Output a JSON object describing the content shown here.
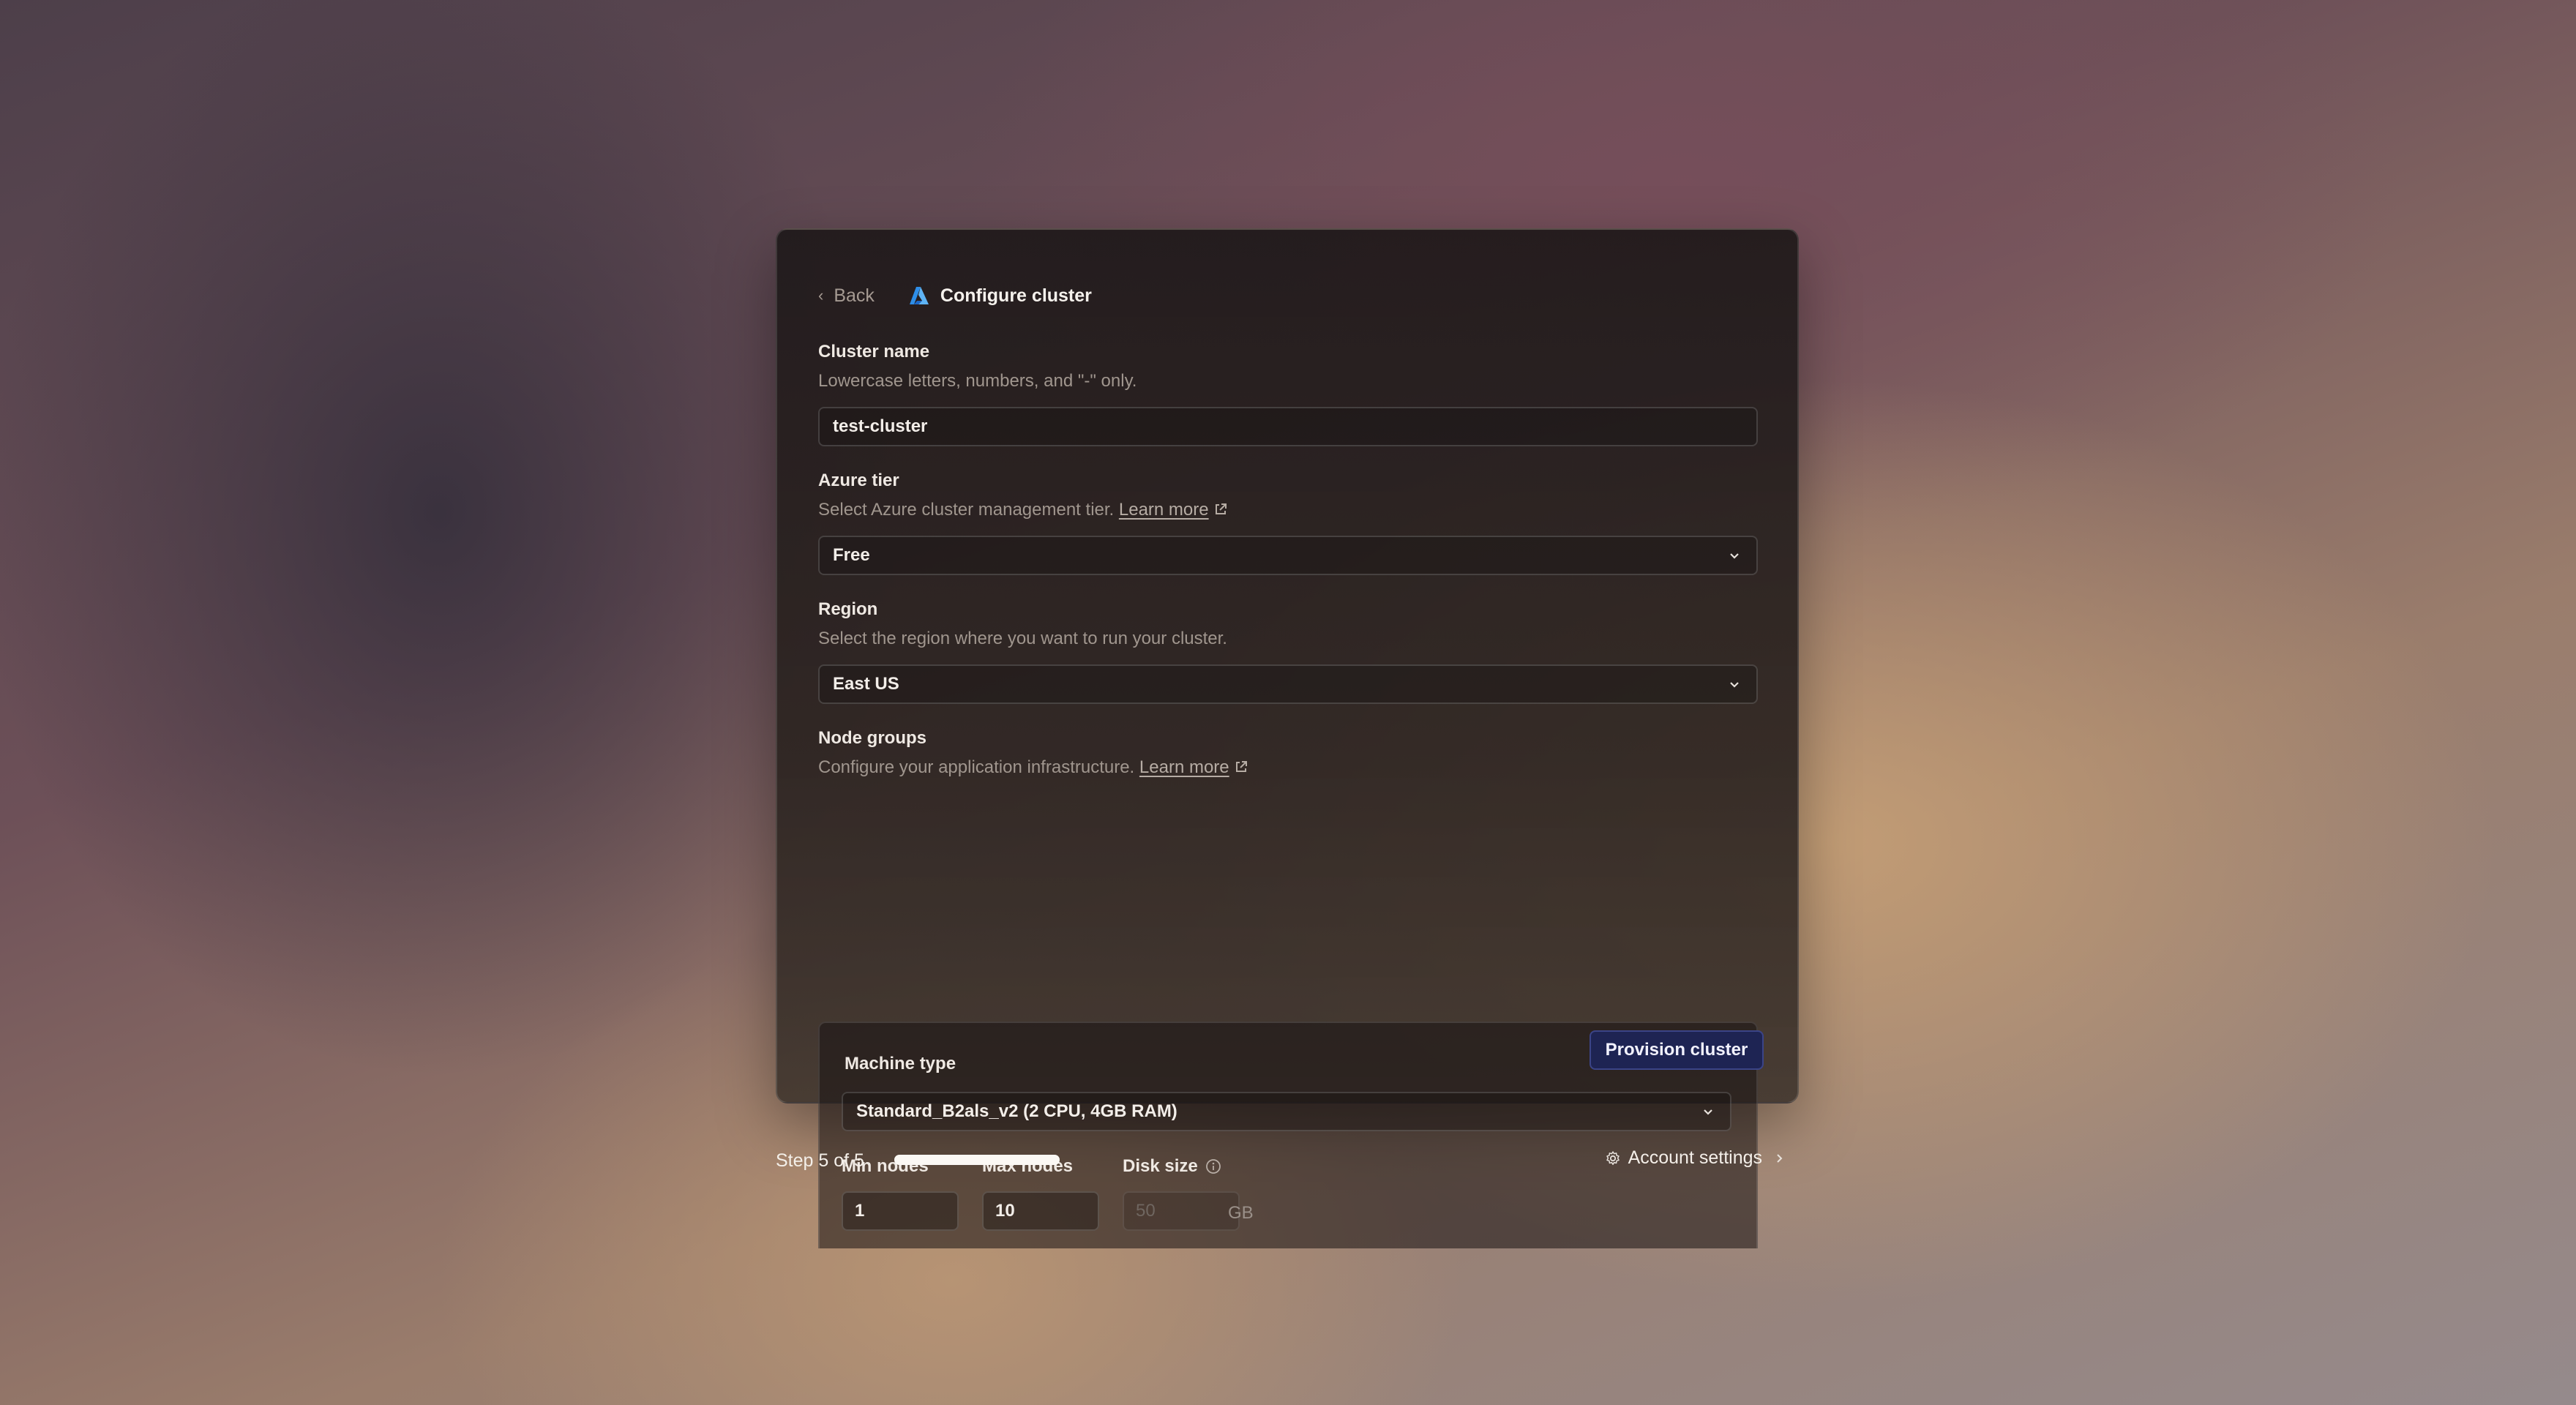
{
  "header": {
    "back_label": "Back",
    "title": "Configure cluster",
    "logo_icon": "azure-logo-icon"
  },
  "cluster_name": {
    "label": "Cluster name",
    "description": "Lowercase letters, numbers, and \"-\" only.",
    "value": "test-cluster"
  },
  "azure_tier": {
    "label": "Azure tier",
    "description": "Select Azure cluster management tier.",
    "link_text": "Learn more",
    "selected": "Free"
  },
  "region": {
    "label": "Region",
    "description": "Select the region where you want to run your cluster.",
    "selected": "East US"
  },
  "node_groups": {
    "label": "Node groups",
    "description": "Configure your application infrastructure.",
    "link_text": "Learn more",
    "machine_type_label": "Machine type",
    "machine_type_selected": "Standard_B2als_v2 (2 CPU, 4GB RAM)",
    "min_nodes_label": "Min nodes",
    "min_nodes_value": "1",
    "max_nodes_label": "Max nodes",
    "max_nodes_value": "10",
    "disk_size_label": "Disk size",
    "disk_size_value": "50",
    "disk_size_unit": "GB"
  },
  "actions": {
    "provision_label": "Provision cluster"
  },
  "footer": {
    "step_text": "Step 5 of 5",
    "progress": 1.0,
    "account_settings_label": "Account settings"
  },
  "colors": {
    "primary_button": "#1e2453",
    "azure_blue": "#2e8ee8"
  }
}
